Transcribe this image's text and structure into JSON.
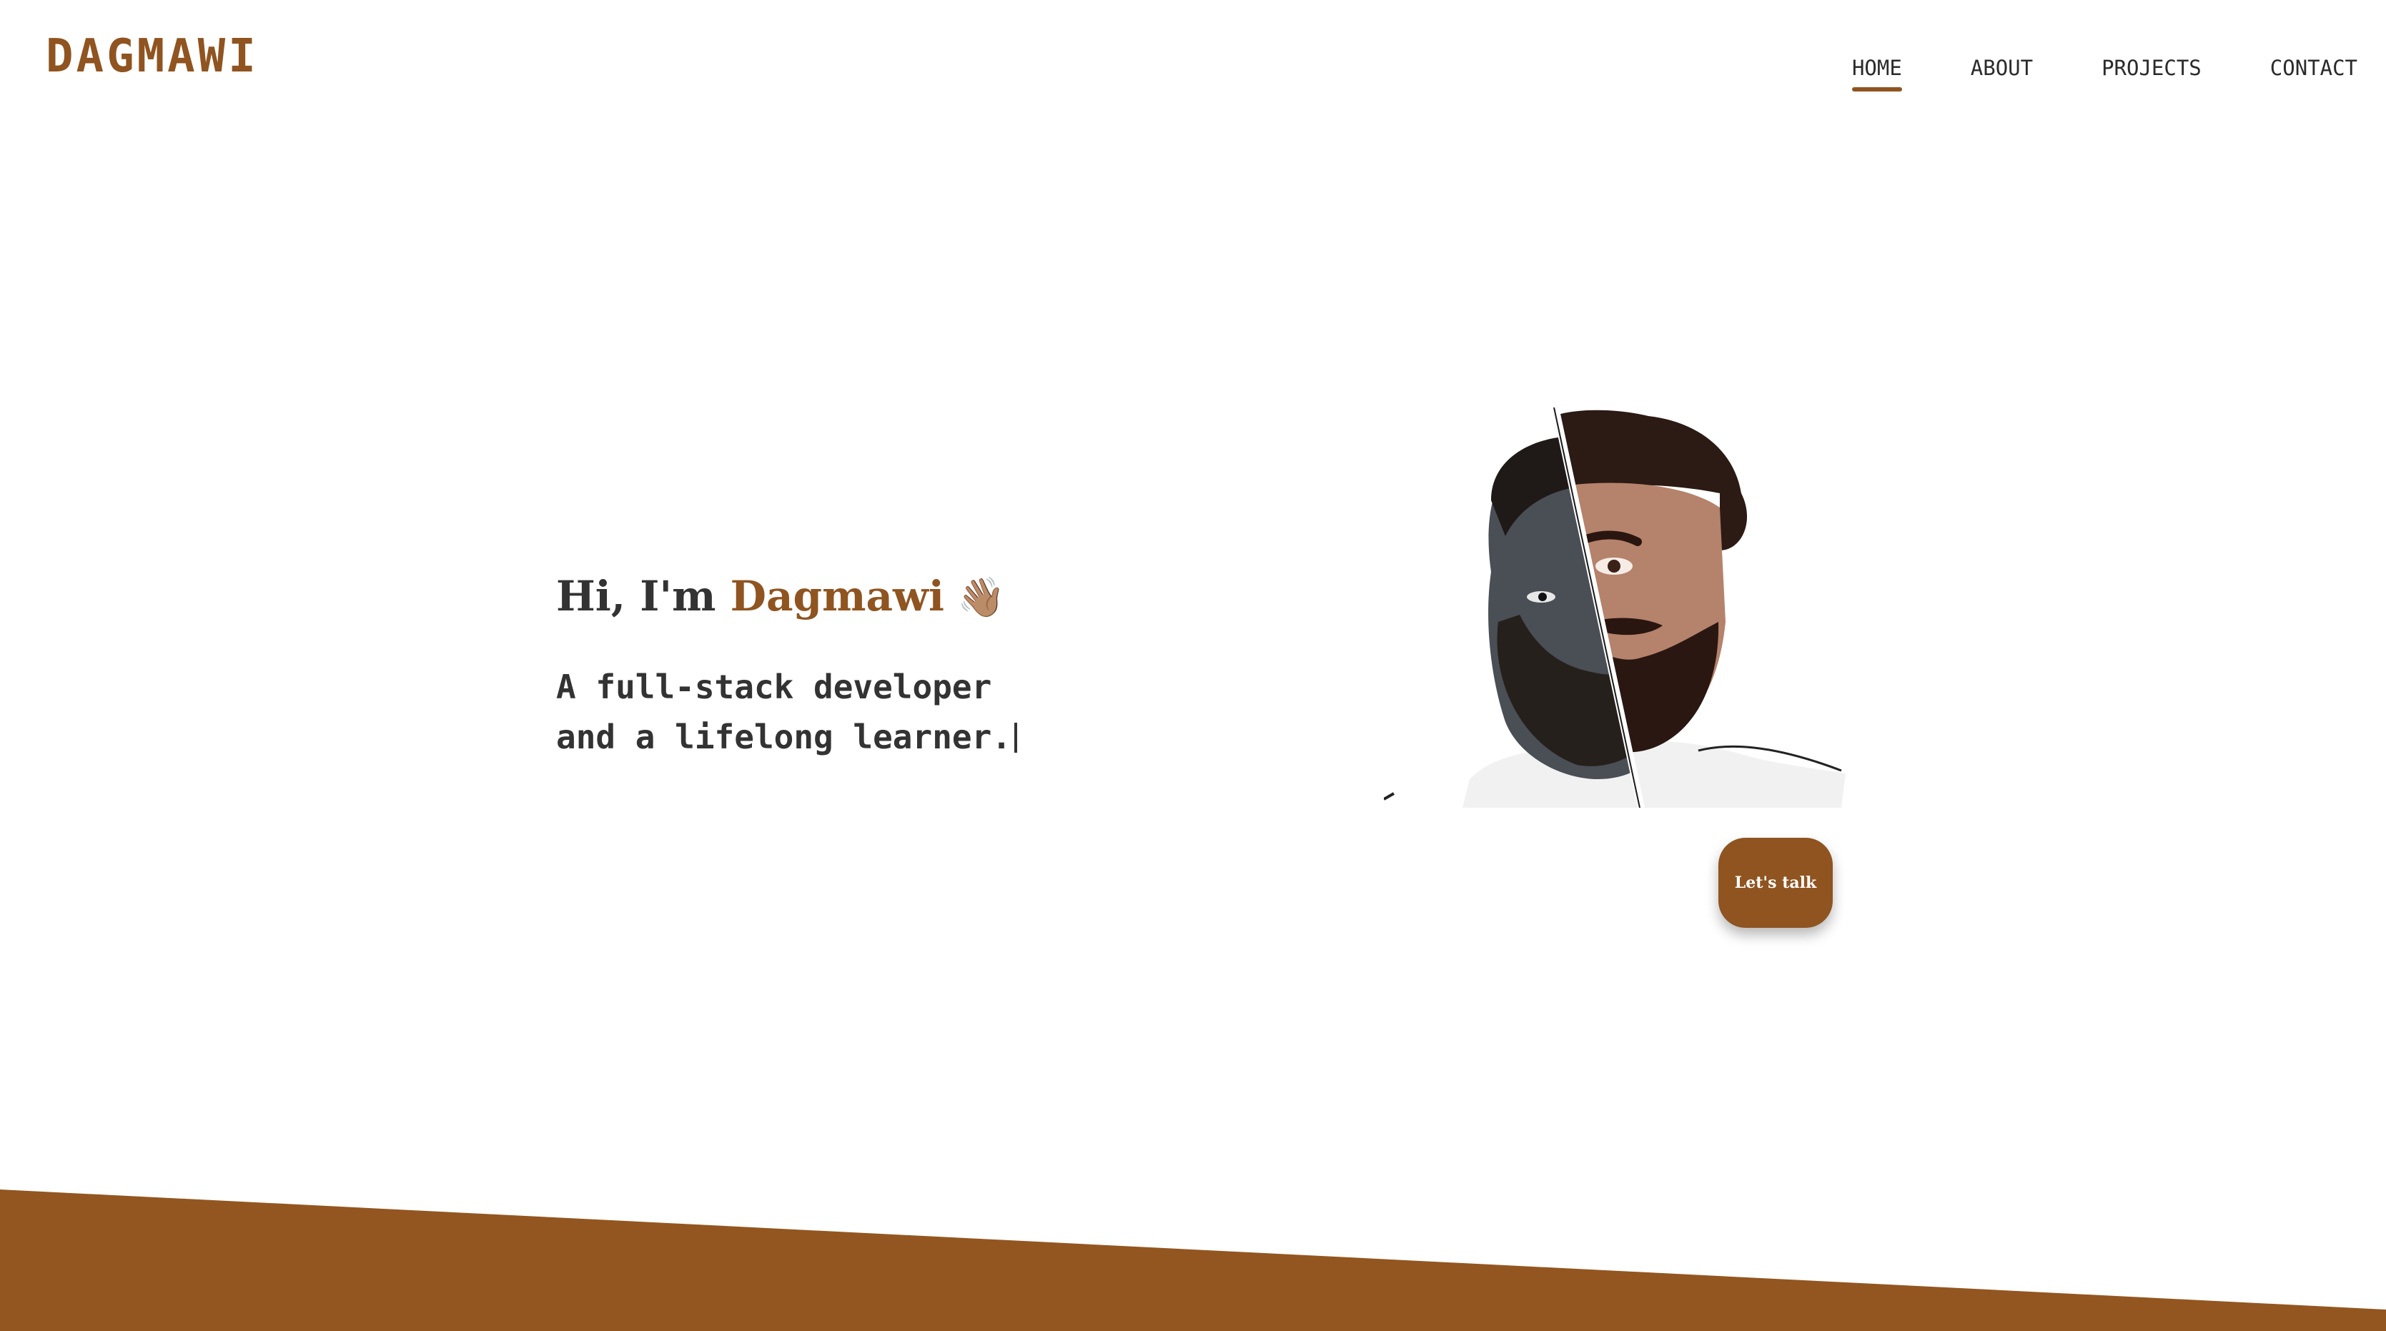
{
  "header": {
    "logo": "DAGMAWI",
    "nav": [
      {
        "label": "HOME",
        "active": true
      },
      {
        "label": "ABOUT",
        "active": false
      },
      {
        "label": "PROJECTS",
        "active": false
      },
      {
        "label": "CONTACT",
        "active": false
      }
    ]
  },
  "hero": {
    "greeting_prefix": "Hi, I'm ",
    "name": "Dagmawi",
    "wave_emoji": "👋🏽",
    "tagline_line1": "A full-stack developer",
    "tagline_line2": "and a lifelong learner.",
    "portrait_icon": "split-portrait-illustration",
    "cta_label": "Let's talk"
  },
  "colors": {
    "accent": "#8f5420",
    "background": "#ffffff",
    "text": "#333333"
  }
}
